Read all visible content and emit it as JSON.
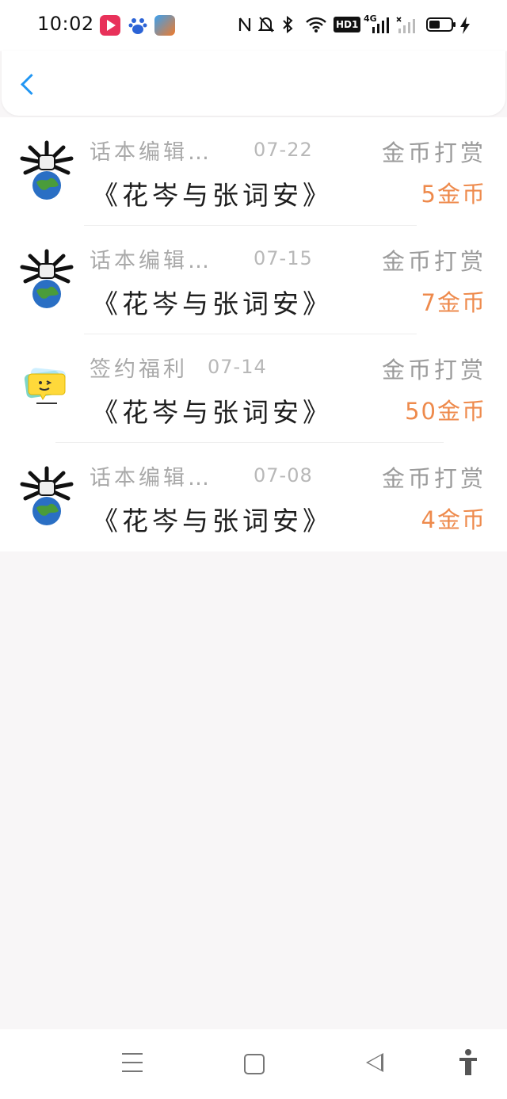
{
  "status_bar": {
    "time": "10:02",
    "icons": [
      "video-app-icon",
      "baidu-icon",
      "browser-icon",
      "nfc-icon",
      "mute-icon",
      "bluetooth-icon",
      "wifi-icon",
      "hd-icon",
      "4g-signal-icon",
      "no-signal-icon",
      "battery-icon",
      "charging-icon"
    ],
    "hd_label": "HD1",
    "net_label": "4G"
  },
  "header": {
    "back_icon": "chevron-left-icon"
  },
  "records": [
    {
      "avatar": "globe-avatar",
      "source": "话本编辑…",
      "date": "07-22",
      "type": "金币打赏",
      "book": "《花岑与张词安》",
      "amount": "5金币"
    },
    {
      "avatar": "globe-avatar",
      "source": "话本编辑…",
      "date": "07-15",
      "type": "金币打赏",
      "book": "《花岑与张词安》",
      "amount": "7金币"
    },
    {
      "avatar": "chat-bubble-avatar",
      "source": "签约福利",
      "date": "07-14",
      "type": "金币打赏",
      "book": "《花岑与张词安》",
      "amount": "50金币"
    },
    {
      "avatar": "globe-avatar",
      "source": "话本编辑…",
      "date": "07-08",
      "type": "金币打赏",
      "book": "《花岑与张词安》",
      "amount": "4金币"
    }
  ],
  "colors": {
    "accent_blue": "#2196f3",
    "amount_orange": "#ee8a4c",
    "page_bg": "#f8f6f7"
  },
  "nav_bar": {
    "icons": [
      "menu-icon",
      "home-icon",
      "back-triangle-icon",
      "accessibility-icon"
    ]
  }
}
